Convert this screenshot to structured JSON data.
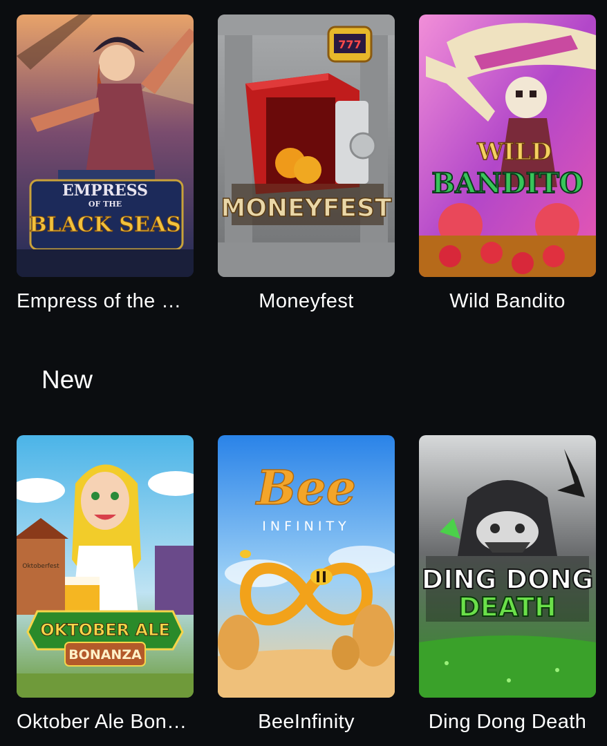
{
  "top_row": [
    {
      "title": "Empress of the …",
      "art_text_1": "EMPRESS",
      "art_text_2": "OF THE",
      "art_text_3": "BLACK SEAS"
    },
    {
      "title": "Moneyfest",
      "art_text_1": "MONEYFEST",
      "art_text_2": "777"
    },
    {
      "title": "Wild Bandito",
      "art_text_1": "WILD",
      "art_text_2": "BANDITO"
    }
  ],
  "section": {
    "title": "New"
  },
  "bottom_row": [
    {
      "title": "Oktober Ale Bon…",
      "art_text_1": "OKTOBER ALE",
      "art_text_2": "BONANZA",
      "art_text_3": "Oktoberfest"
    },
    {
      "title": "BeeInfinity",
      "art_text_1": "Bee",
      "art_text_2": "INFINITY"
    },
    {
      "title": "Ding Dong Death",
      "art_text_1": "DING DONG",
      "art_text_2": "DEATH"
    }
  ],
  "colors": {
    "background": "#0b0d10",
    "text": "#ffffff"
  }
}
